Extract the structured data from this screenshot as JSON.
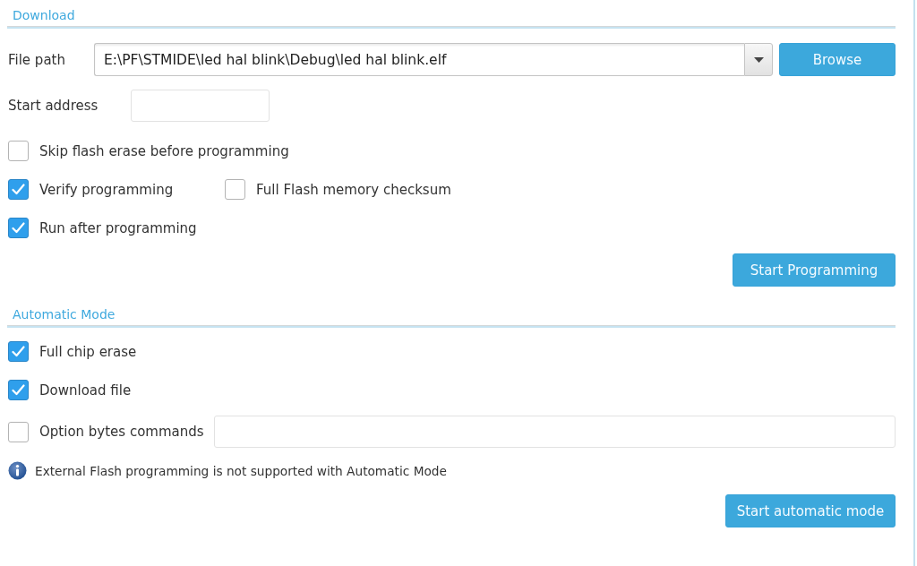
{
  "download": {
    "title": "Download",
    "file_path": {
      "label": "File path",
      "value": "E:\\PF\\STMIDE\\led hal blink\\Debug\\led hal blink.elf"
    },
    "browse_button": "Browse",
    "start_address": {
      "label": "Start address"
    },
    "option_rows": [
      {
        "items": [
          {
            "label": "Skip flash erase before programming",
            "checked": false
          }
        ]
      },
      {
        "items": [
          {
            "label": "Verify programming",
            "checked": true
          },
          {
            "label": "Full Flash memory checksum",
            "checked": false
          }
        ]
      },
      {
        "items": [
          {
            "label": "Run after programming",
            "checked": true
          }
        ]
      }
    ],
    "start_button": "Start Programming"
  },
  "automatic_mode": {
    "title": "Automatic Mode",
    "options": [
      {
        "kind": "checkbox",
        "label": "Full chip erase",
        "checked": true
      },
      {
        "kind": "checkbox",
        "label": "Download file",
        "checked": true
      },
      {
        "kind": "checkbox_with_field",
        "label": "Option bytes commands",
        "checked": false
      }
    ],
    "note": "External Flash programming is not supported with Automatic Mode",
    "start_button": "Start automatic mode"
  }
}
